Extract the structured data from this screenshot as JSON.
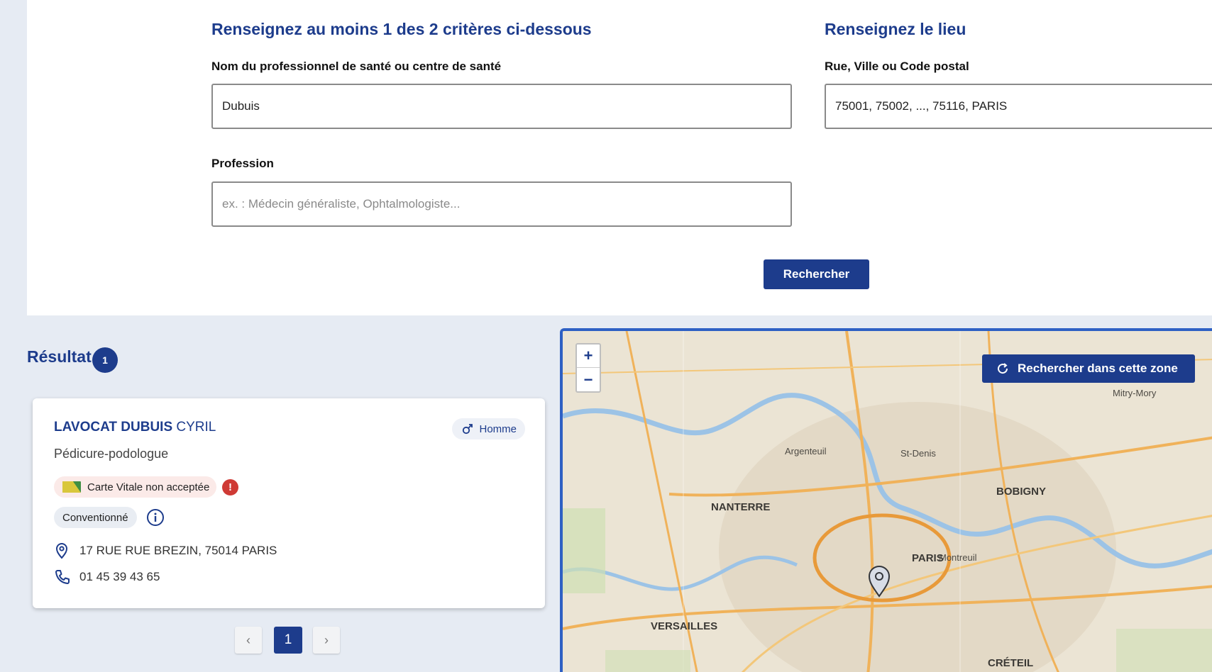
{
  "search": {
    "criteria_title": "Renseignez au moins 1 des 2 critères ci-dessous",
    "name_label": "Nom du professionnel de santé ou centre de santé",
    "name_value": "Dubuis",
    "profession_label": "Profession",
    "profession_placeholder": "ex. : Médecin généraliste, Ophtalmologiste...",
    "location_title": "Renseignez le lieu",
    "location_label": "Rue, Ville ou Code postal",
    "location_value": "75001, 75002, ..., 75116, PARIS",
    "submit_label": "Rechercher"
  },
  "results": {
    "title": "Résultat",
    "count": "1",
    "items": [
      {
        "last_name": "LAVOCAT DUBUIS",
        "first_name": "CYRIL",
        "gender": "Homme",
        "profession": "Pédicure-podologue",
        "vitale": "Carte Vitale non acceptée",
        "alert_symbol": "!",
        "convention": "Conventionné",
        "address": "17 RUE RUE BREZIN, 75014 PARIS",
        "phone": "01 45 39 43 65"
      }
    ]
  },
  "pagination": {
    "prev": "‹",
    "current": "1",
    "next": "›"
  },
  "map": {
    "zoom_in": "+",
    "zoom_out": "−",
    "zone_button": "Rechercher dans cette zone",
    "labels": {
      "paris": "PARIS",
      "nanterre": "NANTERRE",
      "bobigny": "BOBIGNY",
      "versailles": "VERSAILLES",
      "creteil": "CRÉTEIL",
      "montreuil": "Montreuil",
      "st_denis": "St-Denis",
      "argenteuil": "Argenteuil",
      "mitry_mory": "Mitry-Mory"
    }
  },
  "colors": {
    "primary": "#1d3c8c",
    "alert": "#cf3a35",
    "map_border": "#2e60c4"
  }
}
